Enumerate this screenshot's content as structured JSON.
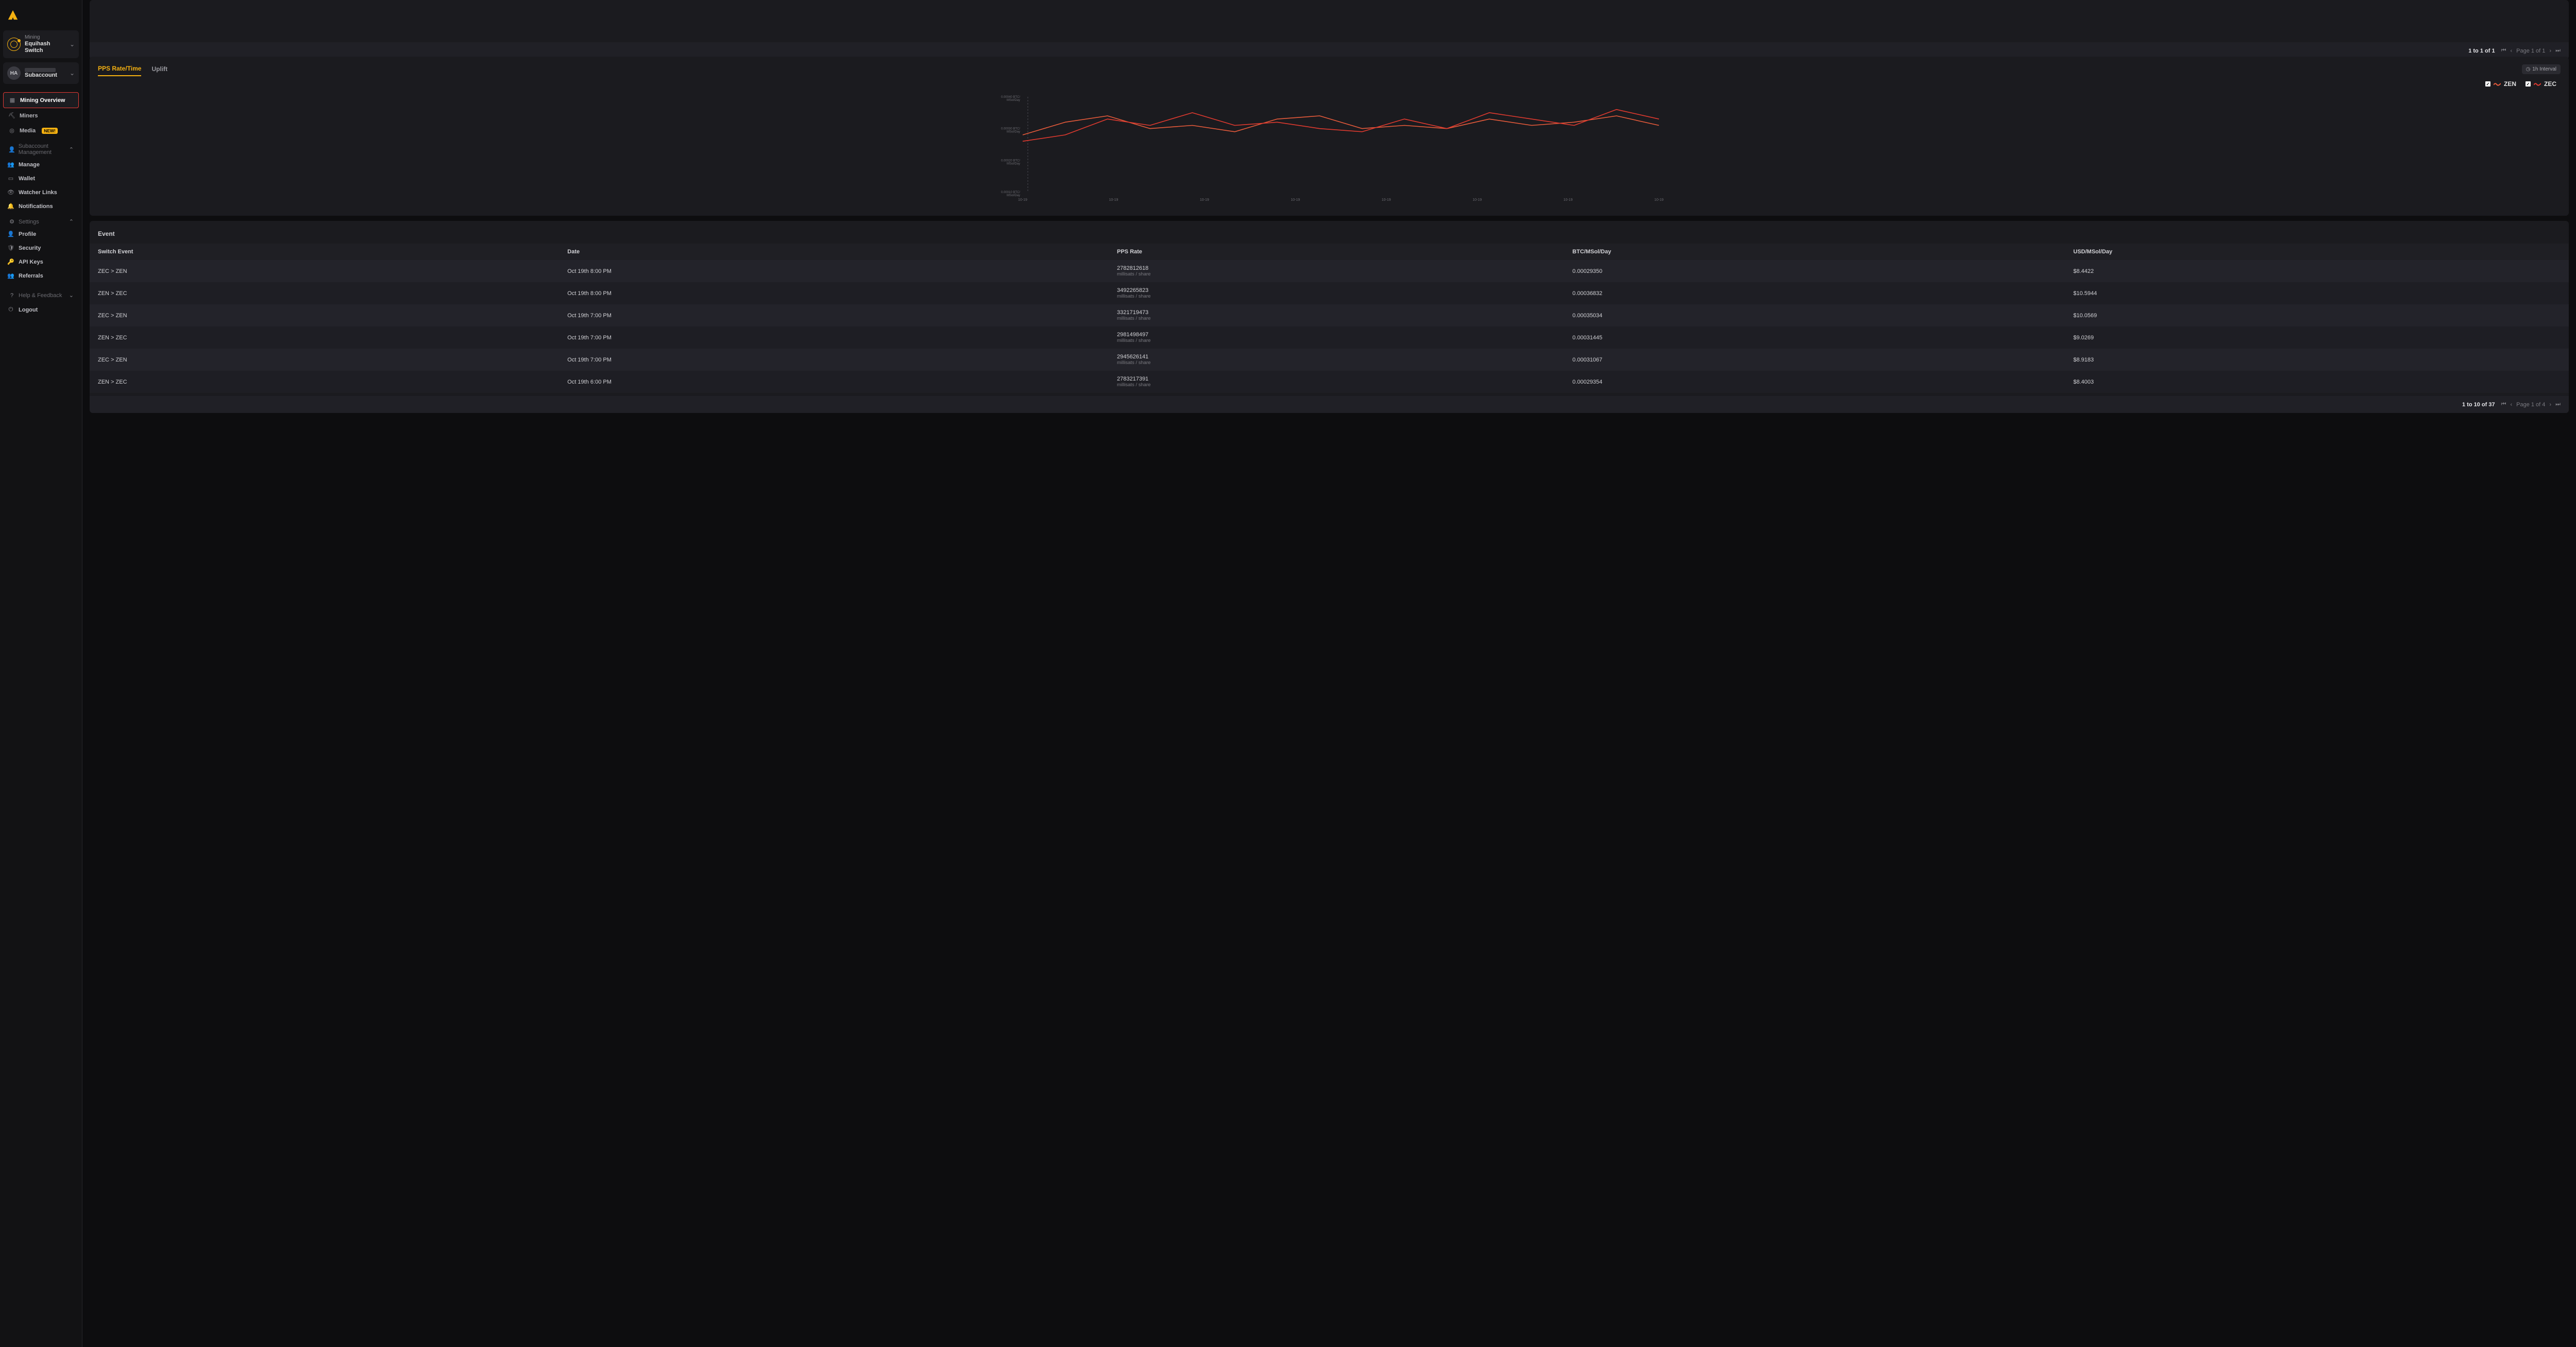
{
  "sidebar": {
    "mining": {
      "top": "Mining",
      "bot": "Equihash Switch"
    },
    "account": {
      "avatar": "HA",
      "bot": "Subaccount"
    },
    "nav": {
      "overview": "Mining Overview",
      "miners": "Miners",
      "media": "Media",
      "media_badge": "NEW!"
    },
    "subaccount_section": "Subaccount Management",
    "subaccount": {
      "manage": "Manage",
      "wallet": "Wallet",
      "watcher": "Watcher Links",
      "notifications": "Notifications"
    },
    "settings_section": "Settings",
    "settings": {
      "profile": "Profile",
      "security": "Security",
      "apikeys": "API Keys",
      "referrals": "Referrals"
    },
    "help": "Help & Feedback",
    "logout": "Logout"
  },
  "pager_top": {
    "range": "1 to 1 of 1",
    "page": "Page 1 of 1"
  },
  "chart": {
    "tab_pps": "PPS Rate/Time",
    "tab_uplift": "Uplift",
    "interval": "1h Interval",
    "legend_zen": "ZEN",
    "legend_zec": "ZEC",
    "y_labels": [
      "0.00040 BTC/\nMSol/Day",
      "0.00030 BTC/\nMSol/Day",
      "0.00020 BTC/\nMSol/Day",
      "0.00010 BTC/\nMSol/Day"
    ],
    "x_label": "10-19"
  },
  "events": {
    "title": "Event",
    "headers": {
      "switch": "Switch Event",
      "date": "Date",
      "pps": "PPS Rate",
      "btc": "BTC/MSol/Day",
      "usd": "USD/MSol/Day"
    },
    "pps_sub": "millisats / share",
    "rows": [
      {
        "sw": "ZEC > ZEN",
        "date": "Oct 19th 8:00 PM",
        "pps": "2782812618",
        "btc": "0.00029350",
        "usd": "$8.4422"
      },
      {
        "sw": "ZEN > ZEC",
        "date": "Oct 19th 8:00 PM",
        "pps": "3492265823",
        "btc": "0.00036832",
        "usd": "$10.5944"
      },
      {
        "sw": "ZEC > ZEN",
        "date": "Oct 19th 7:00 PM",
        "pps": "3321719473",
        "btc": "0.00035034",
        "usd": "$10.0569"
      },
      {
        "sw": "ZEN > ZEC",
        "date": "Oct 19th 7:00 PM",
        "pps": "2981498497",
        "btc": "0.00031445",
        "usd": "$9.0269"
      },
      {
        "sw": "ZEC > ZEN",
        "date": "Oct 19th 7:00 PM",
        "pps": "2945626141",
        "btc": "0.00031067",
        "usd": "$8.9183"
      },
      {
        "sw": "ZEN > ZEC",
        "date": "Oct 19th 6:00 PM",
        "pps": "2783217391",
        "btc": "0.00029354",
        "usd": "$8.4003"
      }
    ]
  },
  "pager_bottom": {
    "range": "1 to 10 of 37",
    "page": "Page 1 of 4"
  },
  "chart_data": {
    "type": "line",
    "x": [
      "10-19",
      "10-19",
      "10-19",
      "10-19",
      "10-19",
      "10-19",
      "10-19",
      "10-19"
    ],
    "yunit": "BTC/MSol/Day",
    "ylim": [
      0.0001,
      0.0004
    ],
    "series": [
      {
        "name": "ZEN",
        "color": "#e85b3b",
        "values": [
          0.00028,
          0.00032,
          0.00034,
          0.0003,
          0.00031,
          0.00029,
          0.00033,
          0.00034,
          0.0003,
          0.00031,
          0.0003,
          0.00033,
          0.00031,
          0.00032,
          0.00034,
          0.00031
        ]
      },
      {
        "name": "ZEC",
        "color": "#e03a2f",
        "values": [
          0.00026,
          0.00028,
          0.00033,
          0.00031,
          0.00035,
          0.00031,
          0.00032,
          0.0003,
          0.00029,
          0.00033,
          0.0003,
          0.00035,
          0.00033,
          0.00031,
          0.00036,
          0.00033
        ]
      }
    ]
  }
}
